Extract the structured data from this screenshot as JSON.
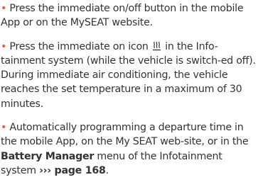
{
  "colors": {
    "bullet": "#e8593c",
    "text": "#333333"
  },
  "items": [
    {
      "bullet": "•",
      "text": " Press the immediate on/off button in the mobile App or on the MySEAT website."
    },
    {
      "bullet": "•",
      "text_before_icon": " Press the immediate on icon ",
      "icon": "climate-heat-icon",
      "text_after_icon": " in the Info-tainment system (while the vehicle is switch-ed off). During immediate air conditioning, the vehicle reaches the set temperature in a maximum of 30 minutes."
    },
    {
      "bullet": "•",
      "text_before_bold": " Automatically programming a departure time in the mobile App, on the My SEAT web-site, or in the ",
      "bold": "Battery Manager",
      "text_after_bold": " menu of the Infotainment system ",
      "link_arrows": "›››",
      "link_text": " page 168",
      "end": "."
    }
  ]
}
